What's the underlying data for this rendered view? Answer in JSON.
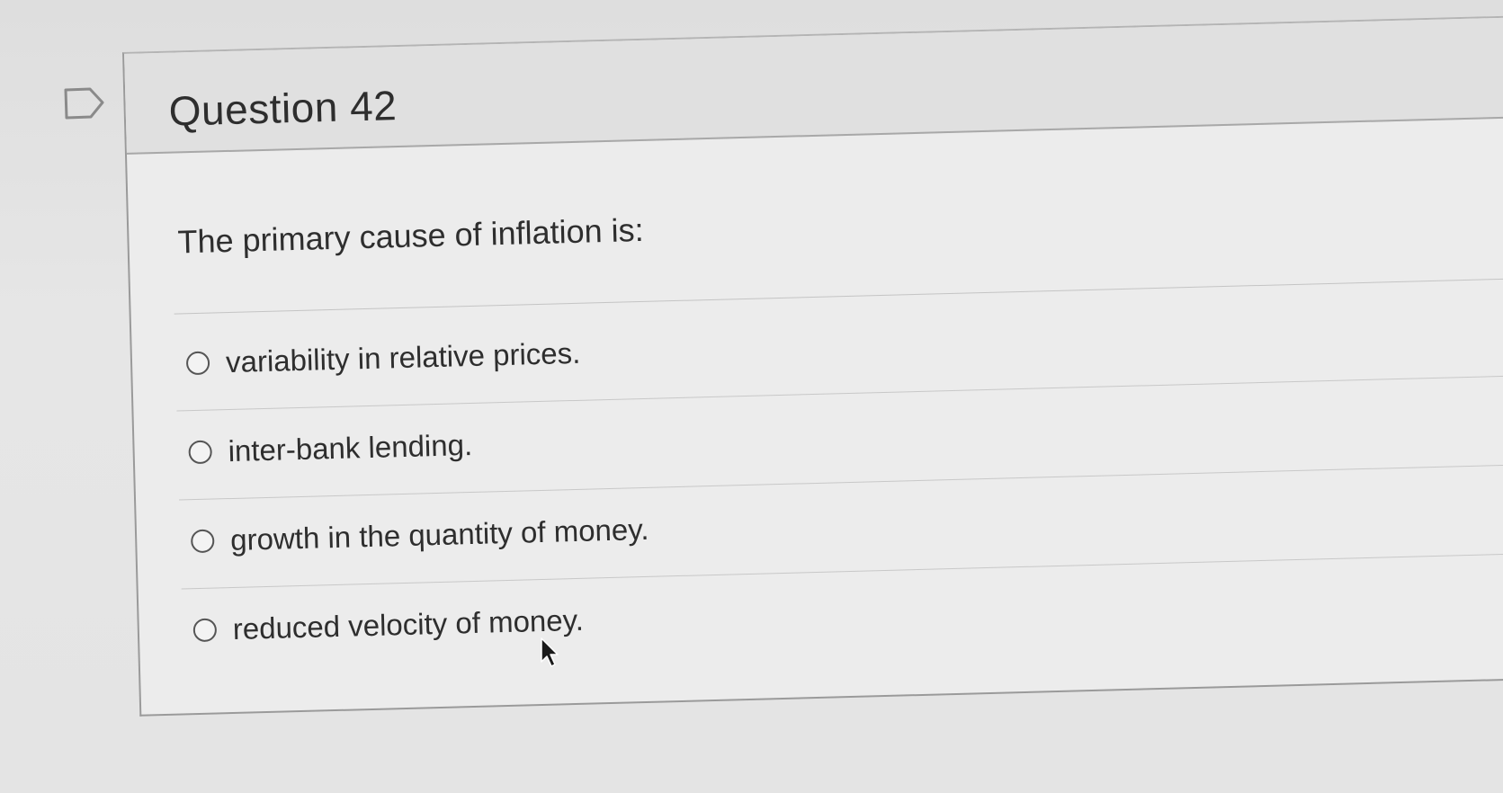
{
  "question": {
    "title": "Question 42",
    "prompt": "The primary cause of inflation is:",
    "answers": [
      {
        "label": "variability in relative prices.",
        "selected": false
      },
      {
        "label": "inter-bank lending.",
        "selected": false
      },
      {
        "label": "growth in the quantity of money.",
        "selected": false
      },
      {
        "label": "reduced velocity of money.",
        "selected": false
      }
    ]
  },
  "icons": {
    "flag": "flag-question-icon",
    "cursor": "mouse-pointer-icon"
  },
  "colors": {
    "background": "#e3e3e3",
    "card": "#ececec",
    "header": "#e0e0e0",
    "text": "#2e2e2e",
    "radio_border": "#555555"
  }
}
